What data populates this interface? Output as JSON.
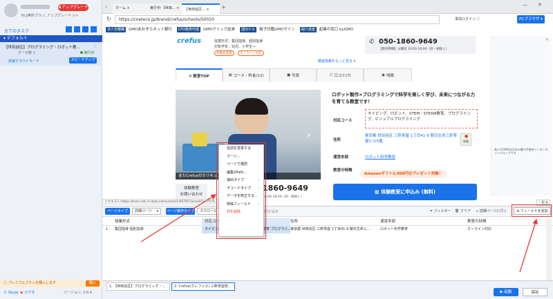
{
  "sidebar": {
    "user_name": "",
    "upgrade_label": "アップグレード",
    "promo_text": "今は無料プラン, アップグレード >>",
    "all_tasks_label": "全てのタスク",
    "group_label": "デフォルト",
    "task": {
      "title": "【世田谷区】プログラミング・ロボット教...",
      "status": "実行中",
      "data_label": "データ数",
      "data_count": "1",
      "cloud_label": "高速クラウドモード",
      "speedup_label": "スピードアップ"
    },
    "premium_text": "プレミアムプランを購入します",
    "buy_label": "購入",
    "skype_label": "Skype",
    "video_label": "ビデオ",
    "version": "バージョン: 3.6.4"
  },
  "tabs": [
    {
      "label": "ホーム"
    },
    {
      "label": "実行中-【世田..."
    },
    {
      "label": "【世田谷区..."
    }
  ],
  "address_bar": {
    "url": "https://coeteco.jp/brand/crefus/schools/50020",
    "prelogin_label": "事前ログイン",
    "pc_browser_label": "PCブラウザ"
  },
  "bookmarks": {
    "tags": [
      "法人労働職",
      "CFD販売代理",
      "国内ドル",
      "紹介送金"
    ],
    "items": [
      "GMOあおぞらネット銀行",
      "GMOクリック証券",
      "電子印鑑GMOサイン",
      "起業の窓口 byGMO"
    ]
  },
  "site": {
    "logo": "crefus",
    "info_line1": "授業形式：集団指導、個別指導",
    "info_line2": "対象学年：幼児、小学生〜",
    "badge1": "体験会実施",
    "badge2": "オンライン対応",
    "phone": "050-1860-9649",
    "hours": "【受付時間】火曜日 10:00-18:00（日・祝除く）",
    "more_info": "教室情報をもっと見る",
    "tabs": [
      "教室TOP",
      "コース・料金(12)",
      "写真",
      "口コミ(7)",
      "地図"
    ],
    "headline": "ロボット製作×プログラミングで科学を楽しく学び、未来につながる力を育てる教室です！",
    "course_label": "対応コース",
    "course_value": "タイピング、ロボット、STEM・STEAM教育、プログラミング、ビジュアルプログラミング",
    "address_label": "住所",
    "address_value": "東京都 世田谷区 三軒茶屋 1丁目41-9 朝日生命三軒茶屋ビル5階",
    "map_label": "地図",
    "operator_label": "運営本部",
    "operator_value": "ロボット科学教育",
    "features_label": "教室の特徴",
    "amazon_text": "Amazonギフト2,000円分プレゼント対象！",
    "photo_caption": "またCrefusのカリキュ...     ...発進中の新型ロボット",
    "trial_label": "体験教室",
    "inquiry_label": "お問い合わせ",
    "phone_big": "1860-9649",
    "hours_small": "10:00-18:00（日・祝除く）",
    "apply_label": "体験教室に申込み (無料)"
  },
  "status_url": "リクエスト:https://bam-cell.nr-data.net/events/1/407657acae0?a=7575...",
  "collapse_label": "折る",
  "context_menu": [
    {
      "label": "名前を変更する",
      "arrow": false
    },
    {
      "label": "マージ...",
      "arrow": false
    },
    {
      "label": "ページで選択",
      "arrow": false
    },
    {
      "label": "編集XPath...",
      "arrow": false
    },
    {
      "label": "抽出タイプ",
      "arrow": true
    },
    {
      "label": "デコードタイプ",
      "arrow": true
    },
    {
      "label": "データを修正する...",
      "arrow": false
    },
    {
      "label": "特殊フィールド",
      "arrow": true
    },
    {
      "label": "列を削除",
      "arrow": false
    }
  ],
  "toolbar": {
    "page_type": "ページタイプ",
    "page_select": "詳細ページ",
    "page_operation": "ページ操作タイプ",
    "scroll_label": "スクロール",
    "filter_label": "フィルター",
    "clear_label": "クリア",
    "detail_label": "詳細ページに行く",
    "add_field_label": "フィールドを追加",
    "replace_label": "置き換え規則を設定"
  },
  "table": {
    "columns": [
      "授業形式",
      "対応コース",
      "住所",
      "運営本部",
      "教室の特徴"
    ],
    "row": {
      "num": "1",
      "cells": [
        "集団指導 個別指導",
        "タイピング ロボット STEM・STEAM教育 プログラミ...",
        "東京都 世田谷区 三軒茶屋 1丁目41-9 朝日生命三...",
        "ロボット科学教育",
        "オンライン対応"
      ]
    }
  },
  "bottom_tabs": [
    "1. 【世田谷区】プログラミング・...",
    "2. Crefus(クレファス) 三軒茶屋校..."
  ],
  "start_label": "起動",
  "save_label": "保存",
  "ad_text": "私たちGMOは日本の最大手総合インターネットグループです"
}
